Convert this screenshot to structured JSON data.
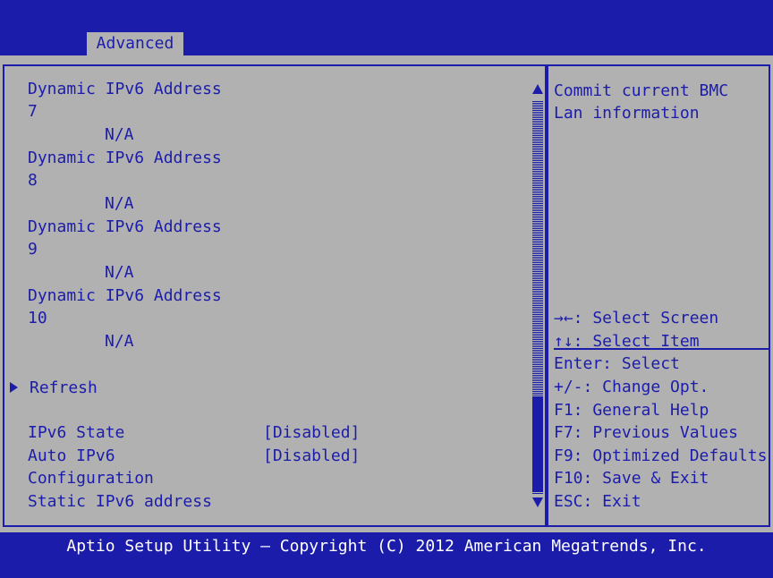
{
  "tabs": {
    "active": "Advanced"
  },
  "main": {
    "lines": [
      "Dynamic IPv6 Address",
      "7",
      "N/A",
      "Dynamic IPv6 Address",
      "8",
      "N/A",
      "Dynamic IPv6 Address",
      "9",
      "N/A",
      "Dynamic IPv6 Address",
      "10",
      "N/A"
    ],
    "refresh_label": "Refresh",
    "ipv6_state_label": "IPv6 State",
    "ipv6_state_value": "[Disabled]",
    "auto_ipv6_label": "Auto IPv6",
    "auto_ipv6_value": "[Disabled]",
    "configuration_label": "Configuration",
    "static_ipv6_label": "Static IPv6 address"
  },
  "help": {
    "line1": "Commit current BMC",
    "line2": "Lan information"
  },
  "keys": [
    "→←: Select Screen",
    "↑↓: Select Item",
    "Enter: Select",
    "+/-: Change Opt.",
    "F1: General Help",
    "F7: Previous Values",
    "F9: Optimized Defaults",
    "F10: Save & Exit",
    "ESC: Exit"
  ],
  "footer": {
    "text": "Aptio Setup Utility – Copyright (C) 2012 American Megatrends, Inc."
  },
  "colors": {
    "background": "#1c1cab",
    "panel": "#b1b1b1",
    "text": "#1c1cab",
    "footer_text": "#ffffff"
  }
}
